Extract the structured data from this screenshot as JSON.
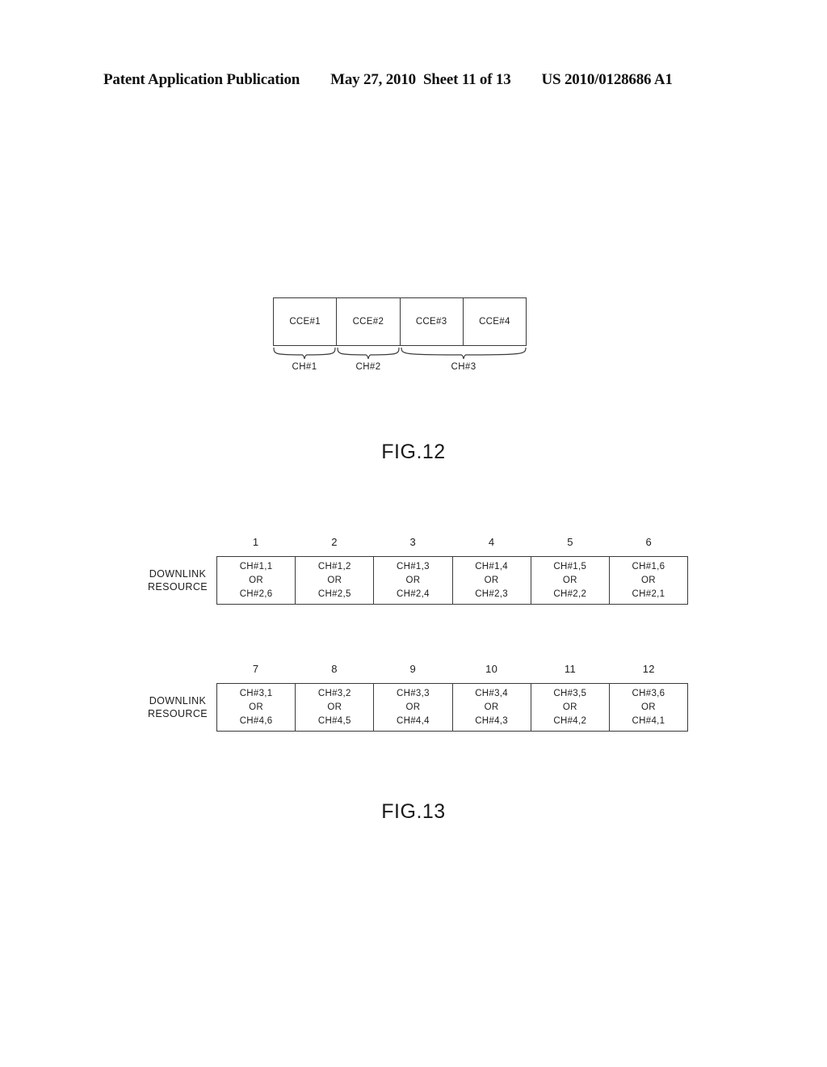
{
  "header": {
    "publication": "Patent Application Publication",
    "date": "May 27, 2010",
    "sheet": "Sheet 11 of 13",
    "pub_number": "US 2010/0128686 A1"
  },
  "fig12": {
    "caption": "FIG.12",
    "cce_cells": [
      "CCE#1",
      "CCE#2",
      "CCE#3",
      "CCE#4"
    ],
    "channel_groups": [
      {
        "label": "CH#1",
        "span_cells": 1
      },
      {
        "label": "CH#2",
        "span_cells": 1
      },
      {
        "label": "CH#3",
        "span_cells": 2
      }
    ]
  },
  "fig13": {
    "caption": "FIG.13",
    "blocks": [
      {
        "row_label_lines": [
          "DOWNLINK",
          "RESOURCE"
        ],
        "column_headers": [
          "1",
          "2",
          "3",
          "4",
          "5",
          "6"
        ],
        "cells": [
          {
            "primary": "CH#1,1",
            "conjunction": "OR",
            "alternate": "CH#2,6"
          },
          {
            "primary": "CH#1,2",
            "conjunction": "OR",
            "alternate": "CH#2,5"
          },
          {
            "primary": "CH#1,3",
            "conjunction": "OR",
            "alternate": "CH#2,4"
          },
          {
            "primary": "CH#1,4",
            "conjunction": "OR",
            "alternate": "CH#2,3"
          },
          {
            "primary": "CH#1,5",
            "conjunction": "OR",
            "alternate": "CH#2,2"
          },
          {
            "primary": "CH#1,6",
            "conjunction": "OR",
            "alternate": "CH#2,1"
          }
        ]
      },
      {
        "row_label_lines": [
          "DOWNLINK",
          "RESOURCE"
        ],
        "column_headers": [
          "7",
          "8",
          "9",
          "10",
          "11",
          "12"
        ],
        "cells": [
          {
            "primary": "CH#3,1",
            "conjunction": "OR",
            "alternate": "CH#4,6"
          },
          {
            "primary": "CH#3,2",
            "conjunction": "OR",
            "alternate": "CH#4,5"
          },
          {
            "primary": "CH#3,3",
            "conjunction": "OR",
            "alternate": "CH#4,4"
          },
          {
            "primary": "CH#3,4",
            "conjunction": "OR",
            "alternate": "CH#4,3"
          },
          {
            "primary": "CH#3,5",
            "conjunction": "OR",
            "alternate": "CH#4,2"
          },
          {
            "primary": "CH#3,6",
            "conjunction": "OR",
            "alternate": "CH#4,1"
          }
        ]
      }
    ]
  },
  "colors": {
    "ink": "#1d1d1d",
    "line": "#3a3a3a",
    "page": "#ffffff"
  }
}
